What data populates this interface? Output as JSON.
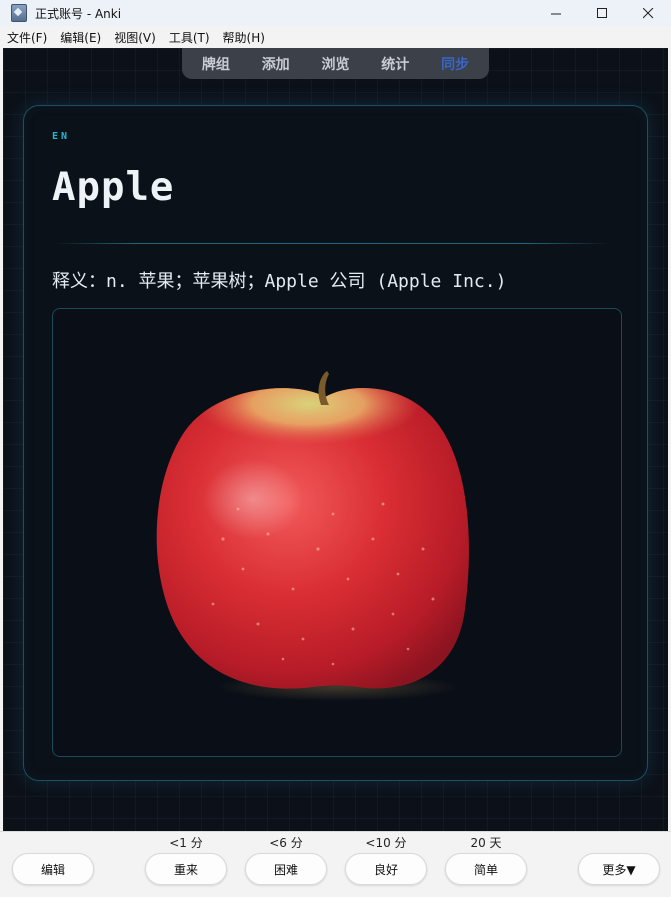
{
  "window": {
    "title": "正式账号 - Anki"
  },
  "menu": [
    "文件(F)",
    "编辑(E)",
    "视图(V)",
    "工具(T)",
    "帮助(H)"
  ],
  "topnav": {
    "items": [
      "牌组",
      "添加",
      "浏览",
      "统计",
      "同步"
    ],
    "active_index": 4
  },
  "card": {
    "lang": "EN",
    "word": "Apple",
    "definition": "释义：n. 苹果；苹果树；Apple 公司 (Apple Inc.)",
    "image_subject": "red apple photo"
  },
  "bottom": {
    "edit_label": "编辑",
    "answers": [
      {
        "interval": "<1 分",
        "label": "重来"
      },
      {
        "interval": "<6 分",
        "label": "困难"
      },
      {
        "interval": "<10 分",
        "label": "良好"
      },
      {
        "interval": "20 天",
        "label": "简单"
      }
    ],
    "more_label": "更多▼"
  },
  "colors": {
    "accent_cyan": "#23b7c8",
    "active_nav": "#3a66c8",
    "background": "#0c1119"
  }
}
